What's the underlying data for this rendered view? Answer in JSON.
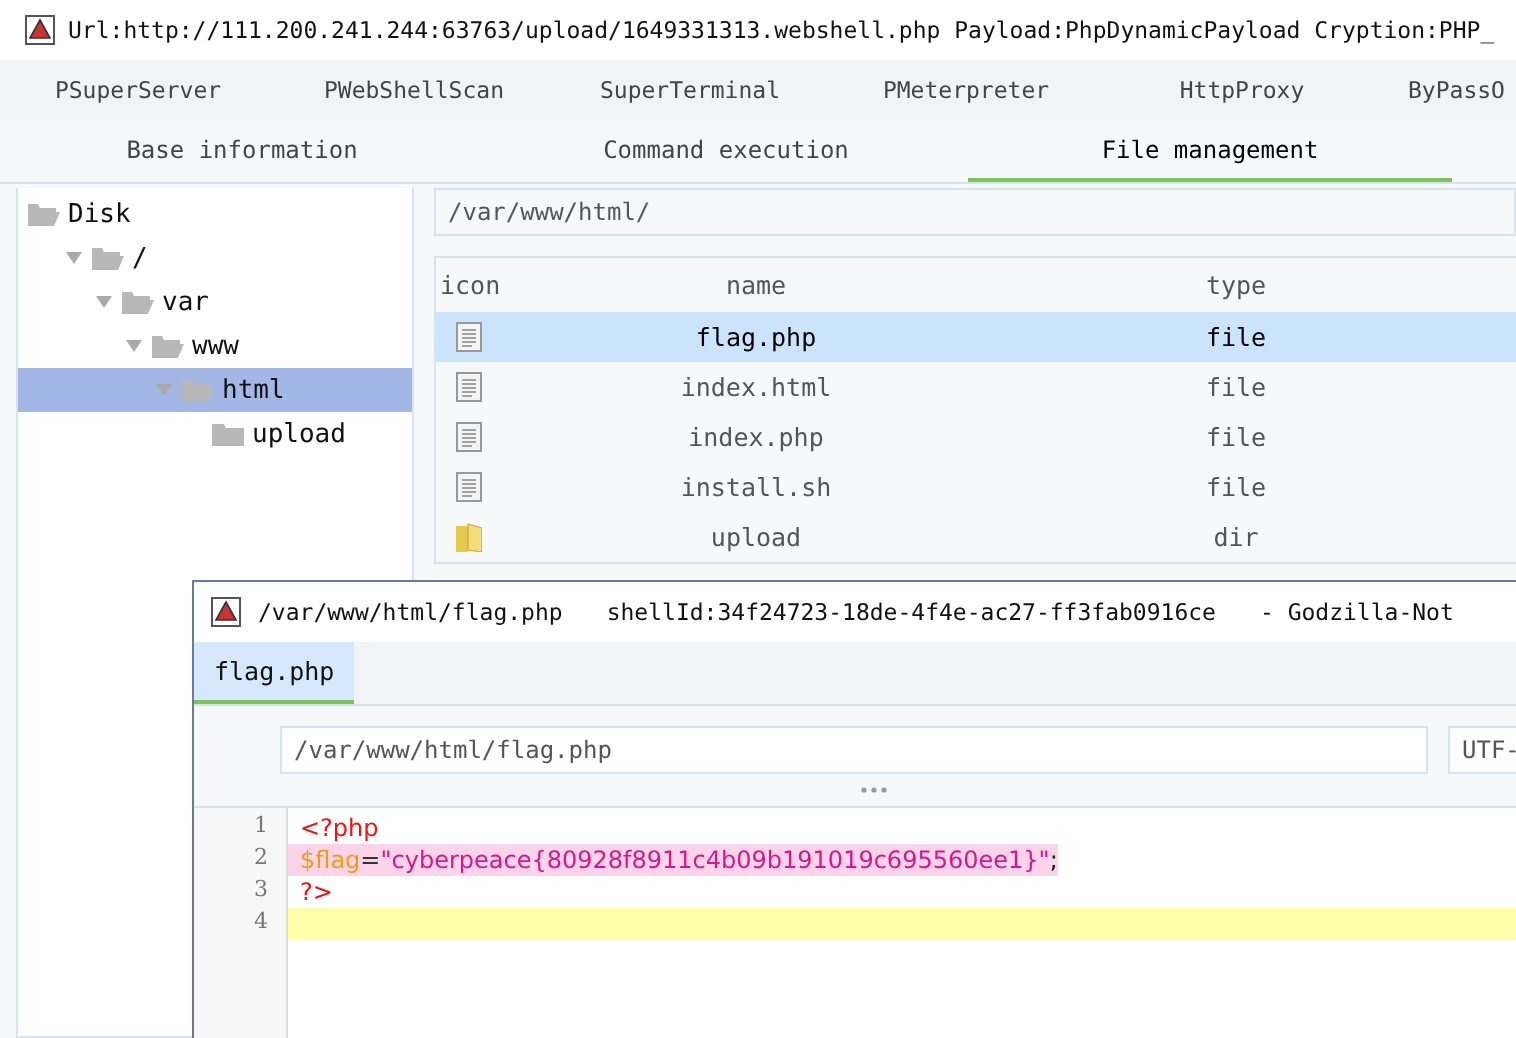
{
  "window": {
    "title": "Url:http://111.200.241.244:63763/upload/1649331313.webshell.php Payload:PhpDynamicPayload Cryption:PHP_"
  },
  "plugin_tabs": [
    {
      "label": "PSuperServer"
    },
    {
      "label": "PWebShellScan"
    },
    {
      "label": "SuperTerminal"
    },
    {
      "label": "PMeterpreter"
    },
    {
      "label": "HttpProxy"
    },
    {
      "label": "ByPassO"
    }
  ],
  "main_tabs": [
    {
      "label": "Base information",
      "selected": false
    },
    {
      "label": "Command execution",
      "selected": false
    },
    {
      "label": "File management",
      "selected": true
    }
  ],
  "tree": [
    {
      "label": "Disk",
      "expanded": true,
      "selected": false,
      "children": [
        {
          "label": "/",
          "expanded": true,
          "selected": false,
          "children": [
            {
              "label": "var",
              "expanded": true,
              "selected": false,
              "children": [
                {
                  "label": "www",
                  "expanded": true,
                  "selected": false,
                  "children": [
                    {
                      "label": "html",
                      "expanded": true,
                      "selected": true,
                      "children": [
                        {
                          "label": "upload",
                          "expanded": false,
                          "selected": false
                        }
                      ]
                    }
                  ]
                }
              ]
            }
          ]
        }
      ]
    }
  ],
  "path_field": {
    "value": "/var/www/html/"
  },
  "file_table": {
    "columns": [
      "icon",
      "name",
      "type"
    ],
    "rows": [
      {
        "kind": "file",
        "name": "flag.php",
        "type": "file",
        "selected": true
      },
      {
        "kind": "file",
        "name": "index.html",
        "type": "file",
        "selected": false
      },
      {
        "kind": "file",
        "name": "index.php",
        "type": "file",
        "selected": false
      },
      {
        "kind": "file",
        "name": "install.sh",
        "type": "file",
        "selected": false
      },
      {
        "kind": "dir",
        "name": "upload",
        "type": "dir",
        "selected": false
      }
    ]
  },
  "editor": {
    "title_path": "/var/www/html/flag.php",
    "shell_id": "shellId:34f24723-18de-4f4e-ac27-ff3fab0916ce",
    "app_name": "- Godzilla-Not",
    "tabs": [
      {
        "label": "flag.php",
        "selected": true
      }
    ],
    "path_field": {
      "value": "/var/www/html/flag.php"
    },
    "encoding_field": {
      "value": "UTF-"
    },
    "lines": [
      {
        "number": "1",
        "current": false,
        "matched": false,
        "tokens": [
          {
            "kind": "tag",
            "text": "<?php"
          }
        ]
      },
      {
        "number": "2",
        "current": false,
        "matched": true,
        "tokens": [
          {
            "kind": "variable",
            "text": "$flag"
          },
          {
            "kind": "operator",
            "text": "="
          },
          {
            "kind": "string",
            "text": "\"cyberpeace{80928f8911c4b09b191019c695560ee1}\""
          },
          {
            "kind": "plain",
            "text": ";"
          }
        ]
      },
      {
        "number": "3",
        "current": false,
        "matched": false,
        "tokens": [
          {
            "kind": "tag",
            "text": "?>"
          }
        ]
      },
      {
        "number": "4",
        "current": true,
        "matched": false
      }
    ]
  }
}
